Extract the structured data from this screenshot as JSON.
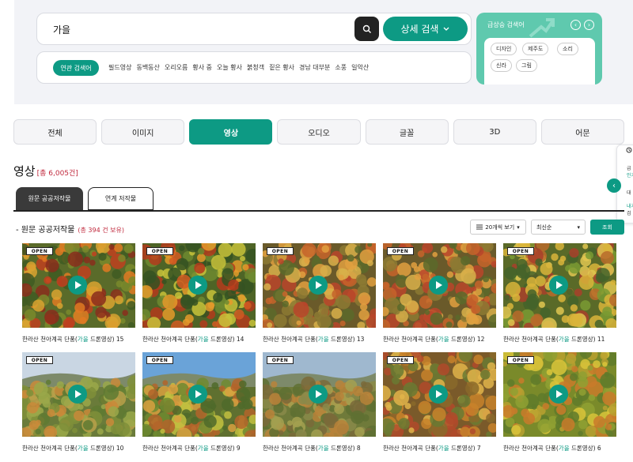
{
  "search": {
    "value": "가을",
    "detail_label": "상세 검색"
  },
  "related": {
    "label": "연관 검색어",
    "terms": [
      "필드영상",
      "동백동산",
      "오리오름",
      "황사 중",
      "오늘 황사",
      "붉청객",
      "짙은 황사",
      "경남 대부분",
      "소풍",
      "일악산"
    ]
  },
  "trending": {
    "title": "급상승 검색어",
    "tags": [
      "디자인",
      "제주도",
      "소리",
      "신라",
      "그림"
    ]
  },
  "tabs": [
    {
      "label": "전체",
      "active": false
    },
    {
      "label": "이미지",
      "active": false
    },
    {
      "label": "영상",
      "active": true
    },
    {
      "label": "오디오",
      "active": false
    },
    {
      "label": "글꼴",
      "active": false
    },
    {
      "label": "3D",
      "active": false
    },
    {
      "label": "어문",
      "active": false
    }
  ],
  "section": {
    "title": "영상",
    "count": "[총 6,005건]"
  },
  "side_panel": {
    "lines": [
      "급",
      "인기",
      "대",
      "내가",
      "검"
    ]
  },
  "subtabs": [
    {
      "label": "원문 공공저작물",
      "active": true
    },
    {
      "label": "연계 저작물",
      "active": false
    }
  ],
  "list": {
    "title": "- 원문 공공저작물",
    "count": "(총 394 건 보유)"
  },
  "controls": {
    "per_page": "20개씩 보기",
    "sort": "최신순",
    "search": "조회"
  },
  "items": [
    {
      "pre": "한라산 천아계곡 단풍(",
      "hl": "가을",
      "post": " 드론영상) 15",
      "scene": "dense-red"
    },
    {
      "pre": "한라산 천아계곡 단풍(",
      "hl": "가을",
      "post": " 드론영상) 14",
      "scene": "dense-mix"
    },
    {
      "pre": "한라산 천아계곡 단풍(",
      "hl": "가을",
      "post": " 드론영상) 13",
      "scene": "dense-orange"
    },
    {
      "pre": "한라산 천아계곡 단풍(",
      "hl": "가을",
      "post": " 드론영상) 12",
      "scene": "dense-orange"
    },
    {
      "pre": "한라산 천아계곡 단풍(",
      "hl": "가을",
      "post": " 드론영상) 11",
      "scene": "dense-yellow"
    },
    {
      "pre": "한라산 천아계곡 단풍(",
      "hl": "가을",
      "post": " 드론영상) 10",
      "scene": "sky-pale"
    },
    {
      "pre": "한라산 천아계곡 단풍(",
      "hl": "가을",
      "post": " 드론영상) 9",
      "scene": "sky-blue"
    },
    {
      "pre": "한라산 천아계곡 단풍(",
      "hl": "가을",
      "post": " 드론영상) 8",
      "scene": "sky-mountain"
    },
    {
      "pre": "한라산 천아계곡 단풍(",
      "hl": "가을",
      "post": " 드론영상) 7",
      "scene": "valley-orange"
    },
    {
      "pre": "한라산 천아계곡 단풍(",
      "hl": "가을",
      "post": " 드론영상) 6",
      "scene": "valley-yellow"
    }
  ],
  "badge_text": "OPEN",
  "colors": {
    "accent": "#0d9a84",
    "count_red": "#c0283c",
    "trend_bg": "#5fc9ae"
  }
}
